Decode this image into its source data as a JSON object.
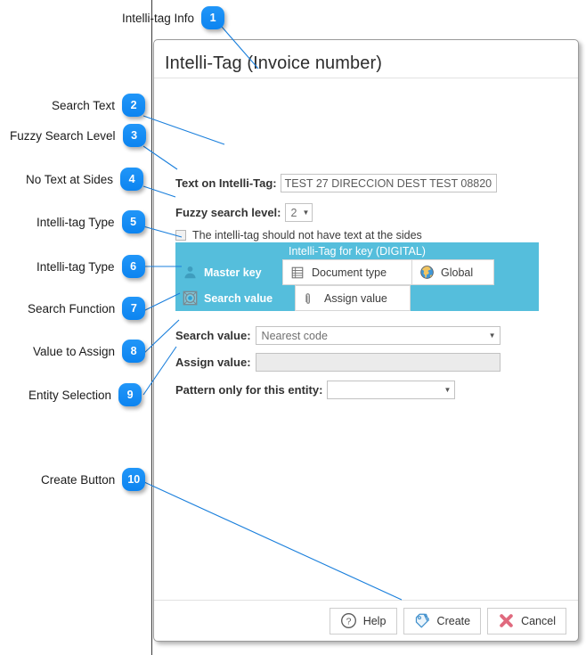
{
  "annotations": [
    {
      "num": "1",
      "label": "Intelli-tag Info"
    },
    {
      "num": "2",
      "label": "Search Text"
    },
    {
      "num": "3",
      "label": "Fuzzy Search Level"
    },
    {
      "num": "4",
      "label": "No Text at Sides"
    },
    {
      "num": "5",
      "label": "Intelli-tag Type"
    },
    {
      "num": "6",
      "label": "Intelli-tag Type"
    },
    {
      "num": "7",
      "label": "Search Function"
    },
    {
      "num": "8",
      "label": "Value to Assign"
    },
    {
      "num": "9",
      "label": "Entity Selection"
    },
    {
      "num": "10",
      "label": "Create Button"
    }
  ],
  "dialog": {
    "title": "Intelli-Tag (Invoice number)",
    "fields": {
      "text_on_tag_label": "Text on Intelli-Tag:",
      "text_on_tag_value": "TEST 27 DIRECCION DEST TEST 08820",
      "fuzzy_label": "Fuzzy search level:",
      "fuzzy_value": "2",
      "no_text_sides_label": "The intelli-tag should not have text at the sides",
      "search_value_label": "Search value:",
      "search_value_selected": "Nearest code",
      "assign_value_label": "Assign value:",
      "assign_value_text": "",
      "pattern_label": "Pattern only for this entity:",
      "pattern_selected": ""
    },
    "itag": {
      "bar_title": "Intelli-Tag for key (DIGITAL)",
      "tabs_row1": [
        {
          "label": "Master key",
          "icon": "person-icon",
          "active": true
        },
        {
          "label": "Document type",
          "icon": "document-type-icon",
          "active": false
        },
        {
          "label": "Global",
          "icon": "globe-icon",
          "active": false
        }
      ],
      "tabs_row2": [
        {
          "label": "Search value",
          "icon": "target-icon",
          "active": true
        },
        {
          "label": "Assign value",
          "icon": "paperclip-icon",
          "active": false
        }
      ]
    },
    "footer": {
      "help_label": "Help",
      "create_label": "Create",
      "cancel_label": "Cancel"
    }
  },
  "colors": {
    "accent_cyan": "#55bedc",
    "badge_blue": "#0c84f0",
    "leader_line": "#1a7fdc",
    "cancel_red": "#e06a7e"
  }
}
